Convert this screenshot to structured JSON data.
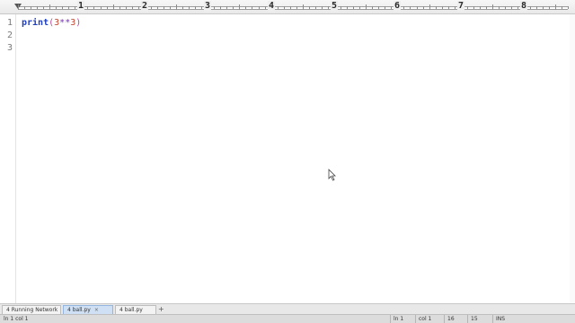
{
  "ruler": {
    "numbers": [
      "1",
      "2",
      "3",
      "4",
      "5",
      "6",
      "7",
      "8"
    ]
  },
  "editor": {
    "line_numbers": [
      "1",
      "2",
      "3"
    ],
    "code": {
      "keyword": "print",
      "open_paren": "(",
      "left_operand": "3",
      "operator": "**",
      "right_operand": "3",
      "close_paren": ")"
    }
  },
  "tabs": [
    {
      "label": "4 Running Network",
      "active": false
    },
    {
      "label": "4 ball.py",
      "active": true
    },
    {
      "label": "4 ball.py",
      "active": false
    }
  ],
  "tab_add_label": "+",
  "tab_close_label": "×",
  "status": {
    "left": "ln 1 col 1",
    "cells": [
      "ln 1",
      "col 1",
      "16",
      "15",
      "INS"
    ]
  },
  "colors": {
    "keyword": "#1f3fbf",
    "number": "#c2452f",
    "active_tab": "#cfe0f5"
  }
}
